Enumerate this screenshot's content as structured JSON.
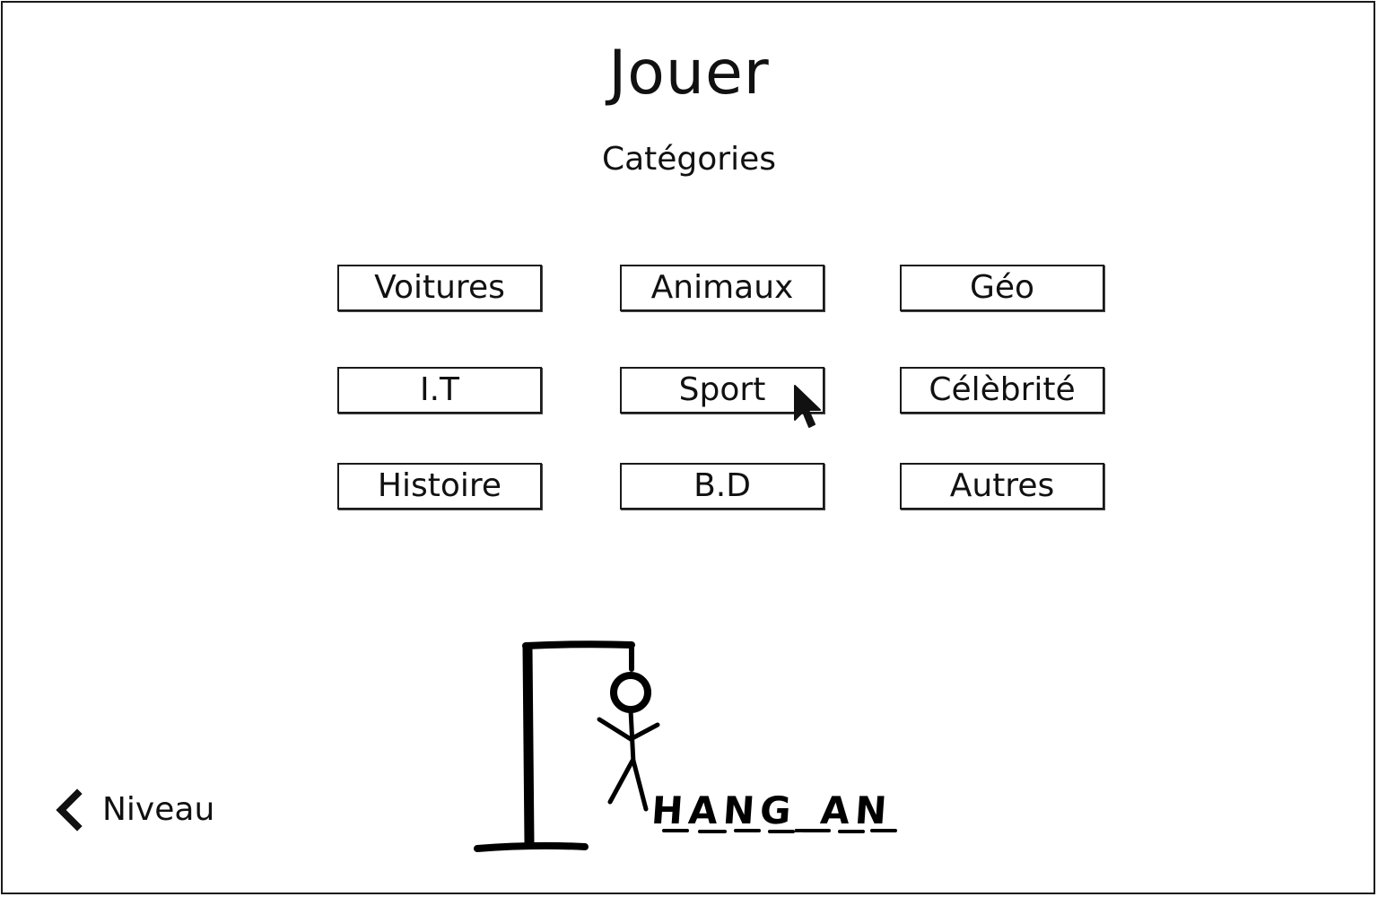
{
  "header": {
    "title": "Jouer",
    "subtitle": "Catégories"
  },
  "categories": [
    {
      "label": "Voitures"
    },
    {
      "label": "Animaux"
    },
    {
      "label": "Géo"
    },
    {
      "label": "I.T"
    },
    {
      "label": "Sport"
    },
    {
      "label": "Célèbrité"
    },
    {
      "label": "Histoire"
    },
    {
      "label": "B.D"
    },
    {
      "label": "Autres"
    }
  ],
  "back": {
    "label": "Niveau",
    "icon": "chevron-left-icon"
  },
  "logo": {
    "text": "HANG_AN",
    "icon": "hangman-icon"
  },
  "cursor": {
    "icon": "mouse-pointer-icon",
    "hover_target": "Sport"
  }
}
